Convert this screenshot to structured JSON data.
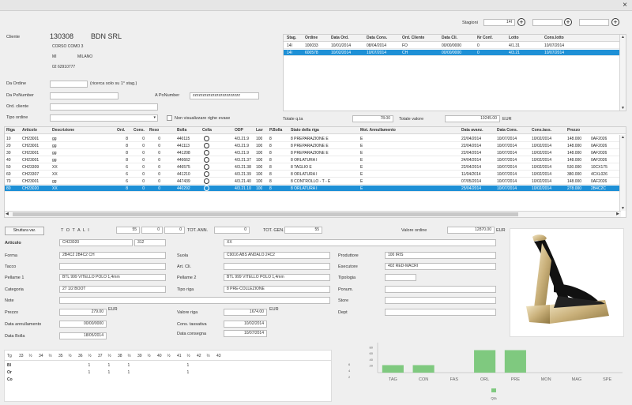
{
  "window": {
    "close": "×"
  },
  "stagioni": {
    "label": "Stagioni",
    "value": "14I"
  },
  "cliente": {
    "label": "Cliente",
    "code": "130308",
    "name": "BDN SRL",
    "address": "CORSO COMO 3",
    "prov": "MI",
    "city": "MILANO",
    "phone": "02 62910777"
  },
  "filters": {
    "da_ordine": "Da Ordine",
    "da_ordine_note": "(ricerca solo su 1° stag.)",
    "da_ponumber": "Da PoNumber",
    "a_ponumber": "A PoNumber",
    "a_ponumber_value": "zzzzzzzzzzzzzzzzzzzzzzzz",
    "ord_cliente": "Ord. cliente",
    "tipo_ordine": "Tipo ordine",
    "non_visualizzare": "Non visualizzare righe evase"
  },
  "orders": {
    "headers": [
      "Stag.",
      "Ordine",
      "Data Ord.",
      "Data Cons.",
      "Ord. Cliente",
      "Data Cli.",
      "Nr Conf.",
      "Lotto",
      "Cons.lotto"
    ],
    "rows": [
      [
        "14I",
        "100033",
        "10/01/2014",
        "08/04/2014",
        "FO",
        "00/00/0000",
        "0",
        "4/1.31",
        "10/07/2014"
      ],
      [
        "14I",
        "600578",
        "10/02/2014",
        "10/07/2014",
        "CH",
        "00/00/0000",
        "0",
        "4/3.21",
        "10/07/2014"
      ]
    ],
    "selected": 1
  },
  "totals_top": {
    "qta_label": "Totale q.ta",
    "qta": "78.00",
    "valore_label": "Totale valore",
    "valore": "19245.00",
    "eur": "EUR"
  },
  "lines": {
    "headers": [
      "Riga",
      "Articolo",
      "Descrizione",
      "Ord.",
      "Cons.",
      "Reso",
      "Bolla",
      "Cella",
      "ODP",
      "Lav",
      "P.Bolla",
      "Stato della riga",
      "Mot. Annullamento",
      "Data avanz.",
      "Data Cons.",
      "Cons.lass.",
      "Prezzo"
    ],
    "rows": [
      [
        "10",
        "CH23001",
        "gg",
        "8",
        "0",
        "0",
        "440115",
        "4/3.21.9",
        "100",
        "8",
        "PREPARAZIONE E",
        "E",
        "22/04/2014",
        "10/07/2014",
        "10/02/2014",
        "148.000",
        "0AF2026"
      ],
      [
        "20",
        "CH23001",
        "gg",
        "8",
        "0",
        "0",
        "441113",
        "4/3.21.9",
        "100",
        "8",
        "PREPARAZIONE E",
        "E",
        "22/04/2014",
        "10/07/2014",
        "10/02/2014",
        "148.000",
        "0AF2026"
      ],
      [
        "30",
        "CH23001",
        "gg",
        "8",
        "0",
        "0",
        "441208",
        "4/3.21.9",
        "100",
        "8",
        "PREPARAZIONE E",
        "E",
        "22/04/2014",
        "10/07/2014",
        "10/02/2014",
        "148.000",
        "0AF2026"
      ],
      [
        "40",
        "CH23001",
        "gg",
        "8",
        "0",
        "0",
        "446662",
        "4/3.21.37",
        "100",
        "8",
        "ORLATURA I",
        "E",
        "24/04/2014",
        "10/07/2014",
        "10/02/2014",
        "148.000",
        "0AF2026"
      ],
      [
        "50",
        "CH23309",
        "XX",
        "6",
        "0",
        "0",
        "446575",
        "4/3.21.38",
        "100",
        "8",
        "TAGLIO E",
        "E",
        "22/04/2014",
        "10/07/2014",
        "10/02/2014",
        "530.000",
        "10CX175"
      ],
      [
        "60",
        "CH23307",
        "XX",
        "6",
        "0",
        "0",
        "441210",
        "4/3.21.39",
        "100",
        "8",
        "ORLATURA I",
        "E",
        "11/04/2014",
        "10/07/2014",
        "10/02/2014",
        "380.000",
        "4CXL026"
      ],
      [
        "70",
        "CH23001",
        "gg",
        "6",
        "0",
        "0",
        "447439",
        "4/3.21.40",
        "100",
        "8",
        "CONTROLLO - T - E",
        "E",
        "07/05/2014",
        "10/07/2014",
        "10/02/2014",
        "148.000",
        "0AF2026"
      ],
      [
        "80",
        "CH23020",
        "XX",
        "8",
        "0",
        "0",
        "440292",
        "4/3.21.10",
        "100",
        "8",
        "ORLATURA I",
        "E",
        "25/04/2014",
        "10/07/2014",
        "10/02/2014",
        "278.000",
        "2B4C2C"
      ]
    ],
    "selected": 7
  },
  "totali": {
    "struttura": "Struttura var.",
    "label": "T O T A L I",
    "ord": "55",
    "cons": "0",
    "reso": "0",
    "tot_ann_label": "TOT. ANN.",
    "tot_ann": "0",
    "tot_gen_label": "TOT. GEN.",
    "tot_gen": "55",
    "val_ord_label": "Valore ordine",
    "val_ord": "12870.00",
    "eur": "EUR"
  },
  "detail": {
    "articolo_label": "Articolo",
    "articolo": "CH23020",
    "articolo2": "312",
    "articolo_desc": "XX",
    "forma_label": "Forma",
    "forma": "2B4C2 2B4C2 CH",
    "suola_label": "Suola",
    "suola": "C9016     ABS ANDALO 24C2",
    "produttore_label": "Produttore",
    "produttore": "100 IRIS",
    "tacco_label": "Tacco",
    "art_cli_label": "Art. Cli.",
    "esecutore_label": "Esecutore",
    "esecutore": "402 RED-MACRI",
    "pellame1_label": "Pellame 1",
    "pellame1": "BTL      999 VITELLO POLO 1,4mm",
    "pellame2_label": "Pellame 2",
    "pellame2": "BTL      999 VITELLO POLO 1,4mm",
    "tipologia_label": "Tipologia",
    "categoria_label": "Categoria",
    "categoria": "27 1/2 BOOT",
    "tipo_riga_label": "Tipo riga",
    "tipo_riga": "8 PRE-COLLEZIONE",
    "ponum_label": "Ponum.",
    "note_label": "Note",
    "store_label": "Store",
    "prezzo_label": "Prezzo",
    "prezzo": "279.00",
    "eur": "EUR",
    "valore_riga_label": "Valore riga",
    "valore_riga": "1674.00",
    "dept_label": "Dept",
    "data_ann_label": "Data annullamento",
    "data_ann": "00/00/0000",
    "cons_tass_label": "Cons. tassativa",
    "cons_tass": "10/02/2014",
    "data_bolla_label": "Data Bolla",
    "data_bolla": "18/05/2014",
    "data_cons_label": "Data consegna",
    "data_cons": "10/07/2014"
  },
  "sizes": {
    "headers": [
      "Tg",
      "33",
      "½",
      "34",
      "½",
      "35",
      "½",
      "36",
      "½",
      "37",
      "½",
      "38",
      "½",
      "39",
      "½",
      "40",
      "½",
      "41",
      "½",
      "42",
      "½",
      "43"
    ],
    "rows": [
      {
        "label": "Bl",
        "values": [
          "",
          "",
          "",
          "",
          "",
          "",
          "1",
          "",
          "1",
          "",
          "1",
          "",
          "",
          "",
          "",
          "",
          "1",
          "",
          "",
          ""
        ]
      },
      {
        "label": "Or",
        "values": [
          "",
          "",
          "",
          "",
          "",
          "",
          "1",
          "",
          "1",
          "",
          "1",
          "",
          "",
          "",
          "",
          "",
          "1",
          "",
          "",
          ""
        ]
      },
      {
        "label": "Co",
        "values": [
          "",
          "",
          "",
          "",
          "",
          "",
          "",
          "",
          "",
          "",
          "",
          "",
          "",
          "",
          "",
          "",
          "",
          "",
          "",
          ""
        ]
      }
    ]
  },
  "chart_data": {
    "type": "bar",
    "categories": [
      "TAG",
      "CON",
      "FAS",
      "ORL",
      "PRE",
      "MON",
      "MAG",
      "SPE"
    ],
    "values": [
      1,
      1,
      0,
      3,
      3,
      0,
      0,
      0
    ],
    "yticks": [
      "6",
      "4",
      "2"
    ],
    "y_axis_labels": [
      "80",
      "60",
      "40",
      "20"
    ],
    "ylim": [
      0,
      100
    ],
    "legend": "Qta",
    "color": "#7fc97f"
  }
}
